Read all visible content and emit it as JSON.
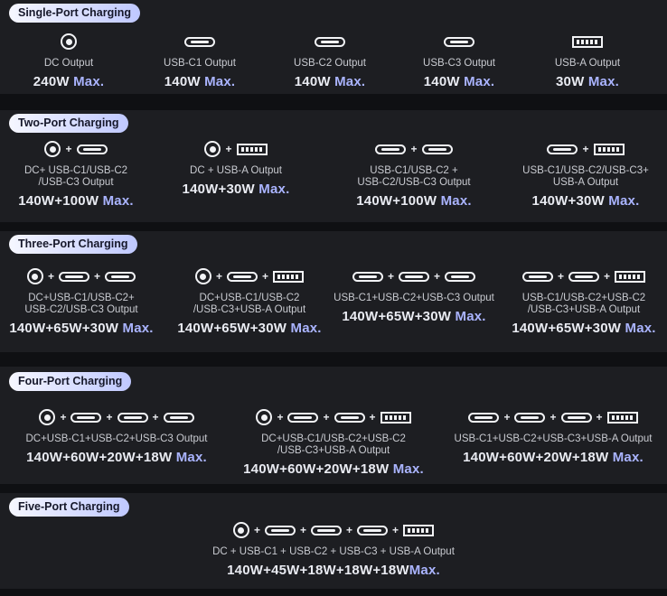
{
  "sections": {
    "single": {
      "title": "Single-Port Charging",
      "items": [
        {
          "label": "DC Output",
          "watts": "240W",
          "max": "Max."
        },
        {
          "label": "USB-C1 Output",
          "watts": "140W",
          "max": "Max."
        },
        {
          "label": "USB-C2 Output",
          "watts": "140W",
          "max": "Max."
        },
        {
          "label": "USB-C3 Output",
          "watts": "140W",
          "max": "Max."
        },
        {
          "label": "USB-A Output",
          "watts": "30W",
          "max": "Max."
        }
      ]
    },
    "two": {
      "title": "Two-Port Charging",
      "items": [
        {
          "label1": "DC+ USB-C1/USB-C2",
          "label2": "/USB-C3 Output",
          "watts": "140W+100W",
          "max": "Max."
        },
        {
          "label1": "DC + USB-A Output",
          "label2": "",
          "watts": "140W+30W",
          "max": "Max."
        },
        {
          "label1": "USB-C1/USB-C2 +",
          "label2": "USB-C2/USB-C3 Output",
          "watts": "140W+100W",
          "max": "Max."
        },
        {
          "label1": "USB-C1/USB-C2/USB-C3+",
          "label2": "USB-A Output",
          "watts": "140W+30W",
          "max": "Max."
        }
      ]
    },
    "three": {
      "title": "Three-Port Charging",
      "items": [
        {
          "label1": "DC+USB-C1/USB-C2+",
          "label2": "USB-C2/USB-C3 Output",
          "watts": "140W+65W+30W",
          "max": "Max."
        },
        {
          "label1": "DC+USB-C1/USB-C2",
          "label2": "/USB-C3+USB-A Output",
          "watts": "140W+65W+30W",
          "max": "Max."
        },
        {
          "label1": "USB-C1+USB-C2+USB-C3 Output",
          "label2": "",
          "watts": "140W+65W+30W",
          "max": "Max."
        },
        {
          "label1": "USB-C1/USB-C2+USB-C2",
          "label2": "/USB-C3+USB-A Output",
          "watts": "140W+65W+30W",
          "max": "Max."
        }
      ]
    },
    "four": {
      "title": "Four-Port Charging",
      "items": [
        {
          "label1": "DC+USB-C1+USB-C2+USB-C3 Output",
          "label2": "",
          "watts": "140W+60W+20W+18W",
          "max": "Max."
        },
        {
          "label1": "DC+USB-C1/USB-C2+USB-C2",
          "label2": "/USB-C3+USB-A Output",
          "watts": "140W+60W+20W+18W",
          "max": "Max."
        },
        {
          "label1": "USB-C1+USB-C2+USB-C3+USB-A Output",
          "label2": "",
          "watts": "140W+60W+20W+18W",
          "max": "Max."
        }
      ]
    },
    "five": {
      "title": "Five-Port Charging",
      "items": [
        {
          "label1": "DC + USB-C1 + USB-C2 + USB-C3 + USB-A Output",
          "label2": "",
          "watts": "140W+45W+18W+18W+18W",
          "max": "Max."
        }
      ]
    }
  },
  "icons": {
    "dc": "dc-port-icon",
    "usbc": "usb-c-port-icon",
    "usba": "usb-a-port-icon"
  },
  "colors": {
    "background": "#0f1013",
    "card": "#1d1e22",
    "accent": "#aab4ff",
    "badge_start": "#f6f7ff",
    "badge_end": "#bfc8ff"
  }
}
